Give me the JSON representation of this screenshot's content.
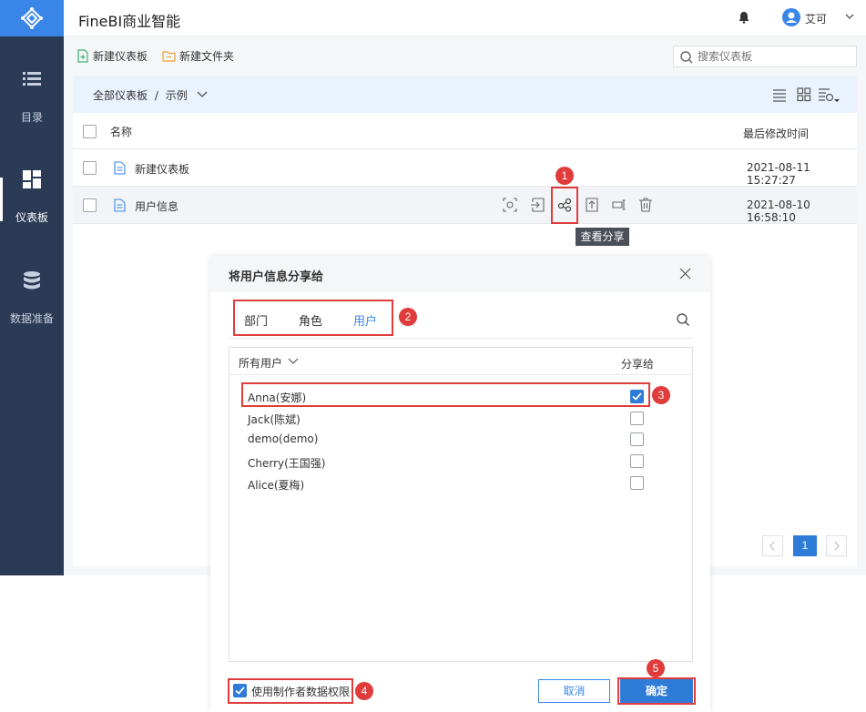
{
  "app": {
    "title": "FineBI商业智能"
  },
  "user": {
    "name": "艾可"
  },
  "sidebar": {
    "items": [
      {
        "label": "目录",
        "icon": "list-icon"
      },
      {
        "label": "仪表板",
        "icon": "dashboard-icon",
        "active": true
      },
      {
        "label": "数据准备",
        "icon": "database-icon"
      }
    ]
  },
  "toolbar": {
    "new_dashboard": "新建仪表板",
    "new_folder": "新建文件夹",
    "search_placeholder": "搜索仪表板"
  },
  "breadcrumb": {
    "root": "全部仪表板",
    "sep": "/",
    "current": "示例"
  },
  "table": {
    "col_name": "名称",
    "col_time": "最后修改时间",
    "rows": [
      {
        "name": "新建仪表板",
        "time": "2021-08-11 15:27:27"
      },
      {
        "name": "用户信息",
        "time": "2021-08-10 16:58:10"
      }
    ]
  },
  "tooltip": "查看分享",
  "badges": [
    "1",
    "2",
    "3",
    "4",
    "5"
  ],
  "dialog": {
    "title": "将用户信息分享给",
    "tabs": [
      {
        "label": "部门",
        "active": false
      },
      {
        "label": "角色",
        "active": false
      },
      {
        "label": "用户",
        "active": true
      }
    ],
    "list_filter": "所有用户",
    "share_col": "分享给",
    "users": [
      {
        "name": "Anna(安娜)",
        "checked": true
      },
      {
        "name": "Jack(陈斌)",
        "checked": false
      },
      {
        "name": "demo(demo)",
        "checked": false
      },
      {
        "name": "Cherry(王国强)",
        "checked": false
      },
      {
        "name": "Alice(夏梅)",
        "checked": false
      }
    ],
    "current_page": "1",
    "use_creator_permission": "使用制作者数据权限",
    "use_creator_permission_checked": true,
    "cancel": "取消",
    "confirm": "确定"
  },
  "colors": {
    "sidebar": "#2b3a55",
    "accent": "#3a86e8",
    "highlight": "#e03c3c"
  }
}
